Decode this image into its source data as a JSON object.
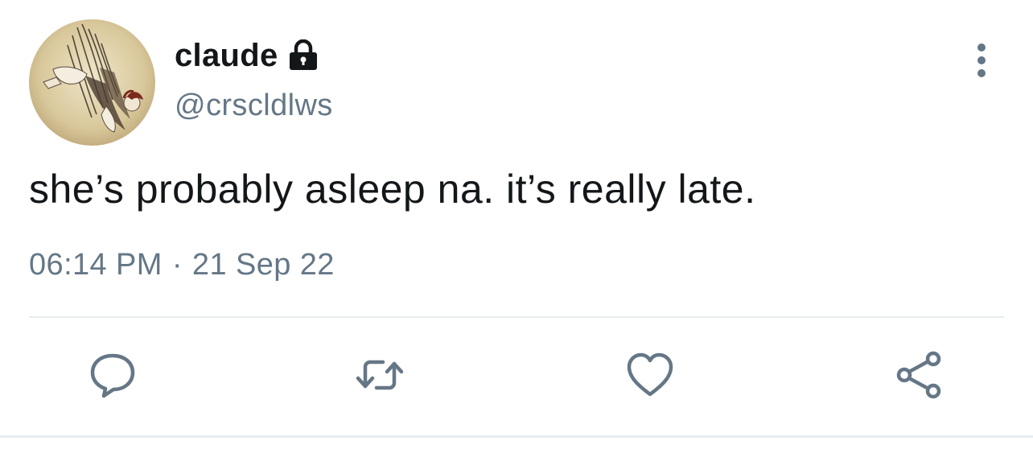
{
  "user": {
    "display_name": "claude",
    "handle": "@crscldlws",
    "protected_icon": "lock-icon",
    "avatar": "avatar-illustration"
  },
  "tweet": {
    "text": "she’s probably asleep na. it’s really late.",
    "time": "06:14 PM",
    "separator": "·",
    "date": "21 Sep 22"
  },
  "menu": {
    "icon": "more-vertical-icon"
  },
  "actions": [
    {
      "name": "reply",
      "icon": "reply-icon"
    },
    {
      "name": "retweet",
      "icon": "retweet-icon"
    },
    {
      "name": "like",
      "icon": "heart-icon"
    },
    {
      "name": "share",
      "icon": "share-icon"
    }
  ],
  "colors": {
    "primary_text": "#14171a",
    "secondary_text": "#657786",
    "icon": "#657786",
    "divider": "#e6ecf0",
    "background": "#ffffff"
  }
}
